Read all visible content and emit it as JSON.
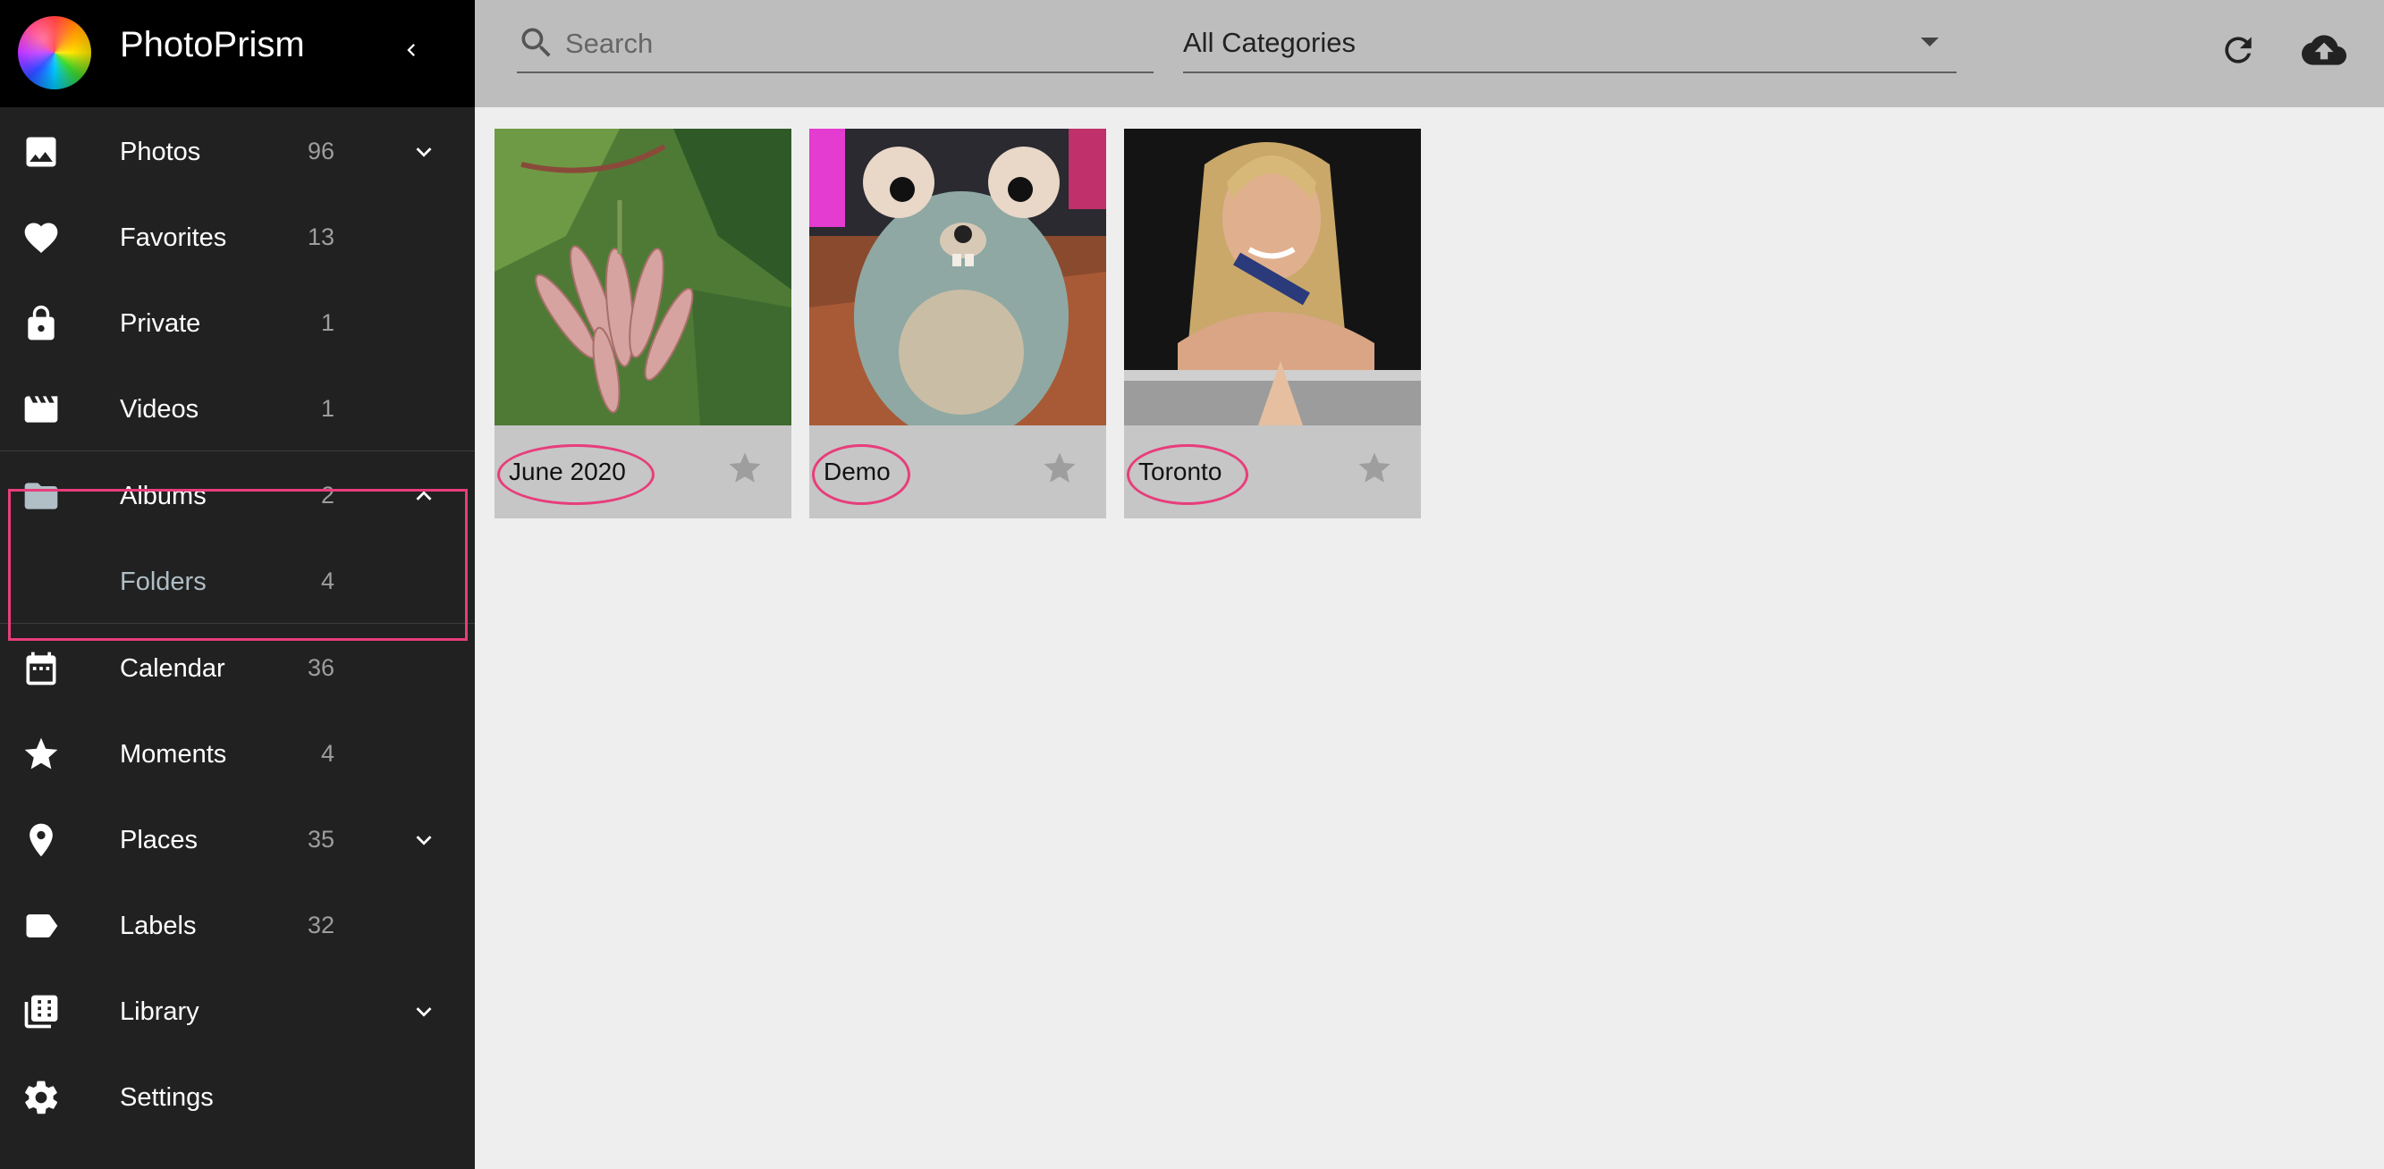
{
  "app": {
    "title": "PhotoPrism"
  },
  "sidebar": {
    "items": [
      {
        "key": "photos",
        "label": "Photos",
        "count": "96",
        "icon": "image-icon",
        "expand": "down"
      },
      {
        "key": "favorites",
        "label": "Favorites",
        "count": "13",
        "icon": "heart-icon"
      },
      {
        "key": "private",
        "label": "Private",
        "count": "1",
        "icon": "lock-icon"
      },
      {
        "key": "videos",
        "label": "Videos",
        "count": "1",
        "icon": "movie-icon"
      },
      {
        "key": "albums",
        "label": "Albums",
        "count": "2",
        "icon": "folder-icon",
        "expand": "up"
      },
      {
        "key": "folders",
        "label": "Folders",
        "count": "4",
        "sub": true
      },
      {
        "key": "calendar",
        "label": "Calendar",
        "count": "36",
        "icon": "calendar-icon"
      },
      {
        "key": "moments",
        "label": "Moments",
        "count": "4",
        "icon": "star-icon"
      },
      {
        "key": "places",
        "label": "Places",
        "count": "35",
        "icon": "place-icon",
        "expand": "down"
      },
      {
        "key": "labels",
        "label": "Labels",
        "count": "32",
        "icon": "label-icon"
      },
      {
        "key": "library",
        "label": "Library",
        "count": "",
        "icon": "library-icon",
        "expand": "down"
      },
      {
        "key": "settings",
        "label": "Settings",
        "count": "",
        "icon": "gear-icon"
      }
    ]
  },
  "toolbar": {
    "search_placeholder": "Search",
    "search_value": "",
    "category": "All Categories"
  },
  "albums": [
    {
      "title": "June 2020",
      "favorite": false
    },
    {
      "title": "Demo",
      "favorite": false
    },
    {
      "title": "Toronto",
      "favorite": false
    }
  ],
  "colors": {
    "highlight": "#e83d7b",
    "sidebar_bg": "#212121",
    "toolbar_bg": "#bdbdbd",
    "content_bg": "#eeeeee"
  }
}
